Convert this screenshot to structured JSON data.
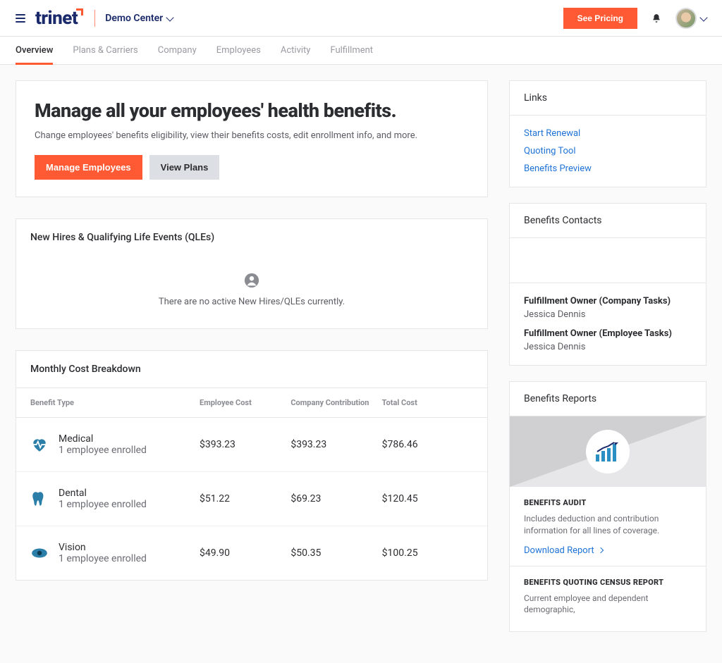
{
  "header": {
    "logo_prefix": "tri",
    "logo_suffix": "net",
    "workspace": "Demo Center",
    "pricing_label": "See Pricing"
  },
  "tabs": [
    {
      "label": "Overview",
      "active": true
    },
    {
      "label": "Plans & Carriers"
    },
    {
      "label": "Company"
    },
    {
      "label": "Employees"
    },
    {
      "label": "Activity"
    },
    {
      "label": "Fulfillment"
    }
  ],
  "hero": {
    "title": "Manage all your employees' health benefits.",
    "subtitle": "Change employees' benefits eligibility, view their benefits costs, edit enrollment info, and more.",
    "primary": "Manage Employees",
    "secondary": "View Plans"
  },
  "qle": {
    "title": "New Hires & Qualifying Life Events (QLEs)",
    "empty": "There are no active New Hires/QLEs currently."
  },
  "cost": {
    "title": "Monthly Cost Breakdown",
    "headers": {
      "type": "Benefit Type",
      "emp": "Employee Cost",
      "comp": "Company Contribution",
      "total": "Total Cost"
    },
    "rows": [
      {
        "name": "Medical",
        "sub": "1 employee enrolled",
        "emp": "$393.23",
        "comp": "$393.23",
        "total": "$786.46",
        "icon": "heart"
      },
      {
        "name": "Dental",
        "sub": "1 employee enrolled",
        "emp": "$51.22",
        "comp": "$69.23",
        "total": "$120.45",
        "icon": "tooth"
      },
      {
        "name": "Vision",
        "sub": "1 employee enrolled",
        "emp": "$49.90",
        "comp": "$50.35",
        "total": "$100.25",
        "icon": "eye"
      }
    ]
  },
  "links": {
    "title": "Links",
    "items": [
      {
        "label": "Start Renewal"
      },
      {
        "label": "Quoting Tool"
      },
      {
        "label": "Benefits Preview"
      }
    ]
  },
  "contacts": {
    "title": "Benefits Contacts",
    "items": [
      {
        "role": "Fulfillment Owner (Company Tasks)",
        "name": "Jessica Dennis"
      },
      {
        "role": "Fulfillment Owner (Employee Tasks)",
        "name": "Jessica Dennis"
      }
    ]
  },
  "reports": {
    "title": "Benefits Reports",
    "sections": [
      {
        "title": "BENEFITS AUDIT",
        "desc": "Includes deduction and contribution information for all lines of coverage.",
        "link": "Download Report"
      },
      {
        "title": "BENEFITS QUOTING CENSUS REPORT",
        "desc": "Current employee and dependent demographic,"
      }
    ]
  }
}
